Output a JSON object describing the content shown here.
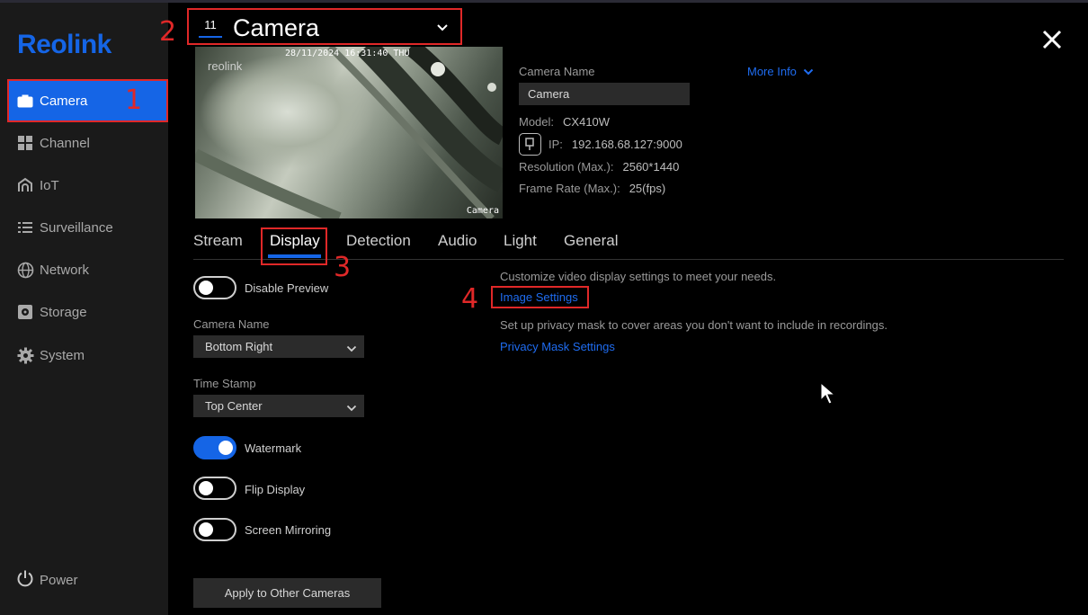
{
  "app": {
    "logo": "Reolink"
  },
  "sidebar": {
    "items": [
      {
        "label": "Camera",
        "icon": "camera-icon",
        "active": true
      },
      {
        "label": "Channel",
        "icon": "grid-icon"
      },
      {
        "label": "IoT",
        "icon": "home-icon"
      },
      {
        "label": "Surveillance",
        "icon": "list-icon"
      },
      {
        "label": "Network",
        "icon": "globe-icon"
      },
      {
        "label": "Storage",
        "icon": "storage-icon"
      },
      {
        "label": "System",
        "icon": "gear-icon"
      }
    ],
    "power_label": "Power"
  },
  "annotations": {
    "n1": "1",
    "n2": "2",
    "n3": "3",
    "n4": "4"
  },
  "header": {
    "channel_number": "11",
    "camera_title": "Camera"
  },
  "preview": {
    "timestamp": "28/11/2024 16:31:40 THU",
    "watermark": "reolink",
    "osd_name": "Camera"
  },
  "info": {
    "camera_name_label": "Camera Name",
    "camera_name_value": "Camera",
    "model_label": "Model:",
    "model_value": "CX410W",
    "ip_label": "IP:",
    "ip_value": "192.168.68.127:9000",
    "resolution_label": "Resolution (Max.):",
    "resolution_value": "2560*1440",
    "framerate_label": "Frame Rate (Max.):",
    "framerate_value": "25(fps)",
    "more_info": "More Info"
  },
  "tabs": [
    {
      "label": "Stream"
    },
    {
      "label": "Display",
      "active": true
    },
    {
      "label": "Detection"
    },
    {
      "label": "Audio"
    },
    {
      "label": "Light"
    },
    {
      "label": "General"
    }
  ],
  "display": {
    "disable_preview_label": "Disable Preview",
    "disable_preview_on": false,
    "camera_name_label": "Camera Name",
    "camera_name_position": "Bottom Right",
    "time_stamp_label": "Time Stamp",
    "time_stamp_position": "Top Center",
    "watermark_label": "Watermark",
    "watermark_on": true,
    "flip_display_label": "Flip Display",
    "flip_display_on": false,
    "screen_mirroring_label": "Screen Mirroring",
    "screen_mirroring_on": false,
    "apply_button": "Apply to Other Cameras",
    "image_desc": "Customize video display settings to meet your needs.",
    "image_settings_link": "Image Settings",
    "privacy_desc": "Set up privacy mask to cover areas you don't want to include in recordings.",
    "privacy_mask_link": "Privacy Mask Settings"
  },
  "colors": {
    "accent": "#1565e6",
    "link": "#1f6cf0",
    "annotation": "#e02828",
    "sidebar_bg": "#1a1a1a",
    "control_bg": "#2b2b2b"
  }
}
